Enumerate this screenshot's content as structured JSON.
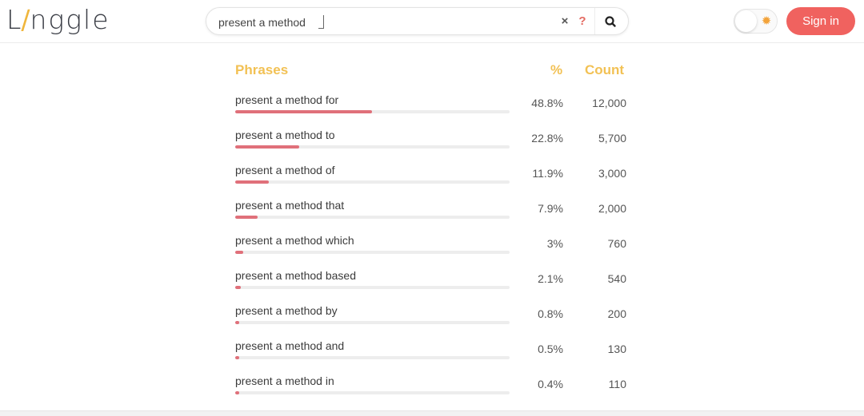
{
  "header": {
    "logo": {
      "prefix": "L",
      "slash": "/",
      "suffix": "nggle"
    },
    "search": {
      "value": "present a method",
      "clear_label": "×",
      "help_label": "?",
      "submit_icon": "search-icon"
    },
    "theme_toggle": {
      "state": "light",
      "icon": "sun-icon"
    },
    "sign_in_label": "Sign in"
  },
  "colors": {
    "accent_header": "#f2c154",
    "bar_fill": "#e0707a",
    "bar_track": "#ededed",
    "sign_in_bg": "#f0625f",
    "logo_slash": "#f0b63c"
  },
  "results": {
    "columns": {
      "phrase": "Phrases",
      "percent": "%",
      "count": "Count"
    },
    "rows": [
      {
        "phrase": "present a method for",
        "percent": "48.8%",
        "count": "12,000",
        "share": 0.488
      },
      {
        "phrase": "present a method to",
        "percent": "22.8%",
        "count": "5,700",
        "share": 0.228
      },
      {
        "phrase": "present a method of",
        "percent": "11.9%",
        "count": "3,000",
        "share": 0.119
      },
      {
        "phrase": "present a method that",
        "percent": "7.9%",
        "count": "2,000",
        "share": 0.079
      },
      {
        "phrase": "present a method which",
        "percent": "3%",
        "count": "760",
        "share": 0.03
      },
      {
        "phrase": "present a method based",
        "percent": "2.1%",
        "count": "540",
        "share": 0.021
      },
      {
        "phrase": "present a method by",
        "percent": "0.8%",
        "count": "200",
        "share": 0.008
      },
      {
        "phrase": "present a method and",
        "percent": "0.5%",
        "count": "130",
        "share": 0.005
      },
      {
        "phrase": "present a method in",
        "percent": "0.4%",
        "count": "110",
        "share": 0.004
      }
    ]
  }
}
